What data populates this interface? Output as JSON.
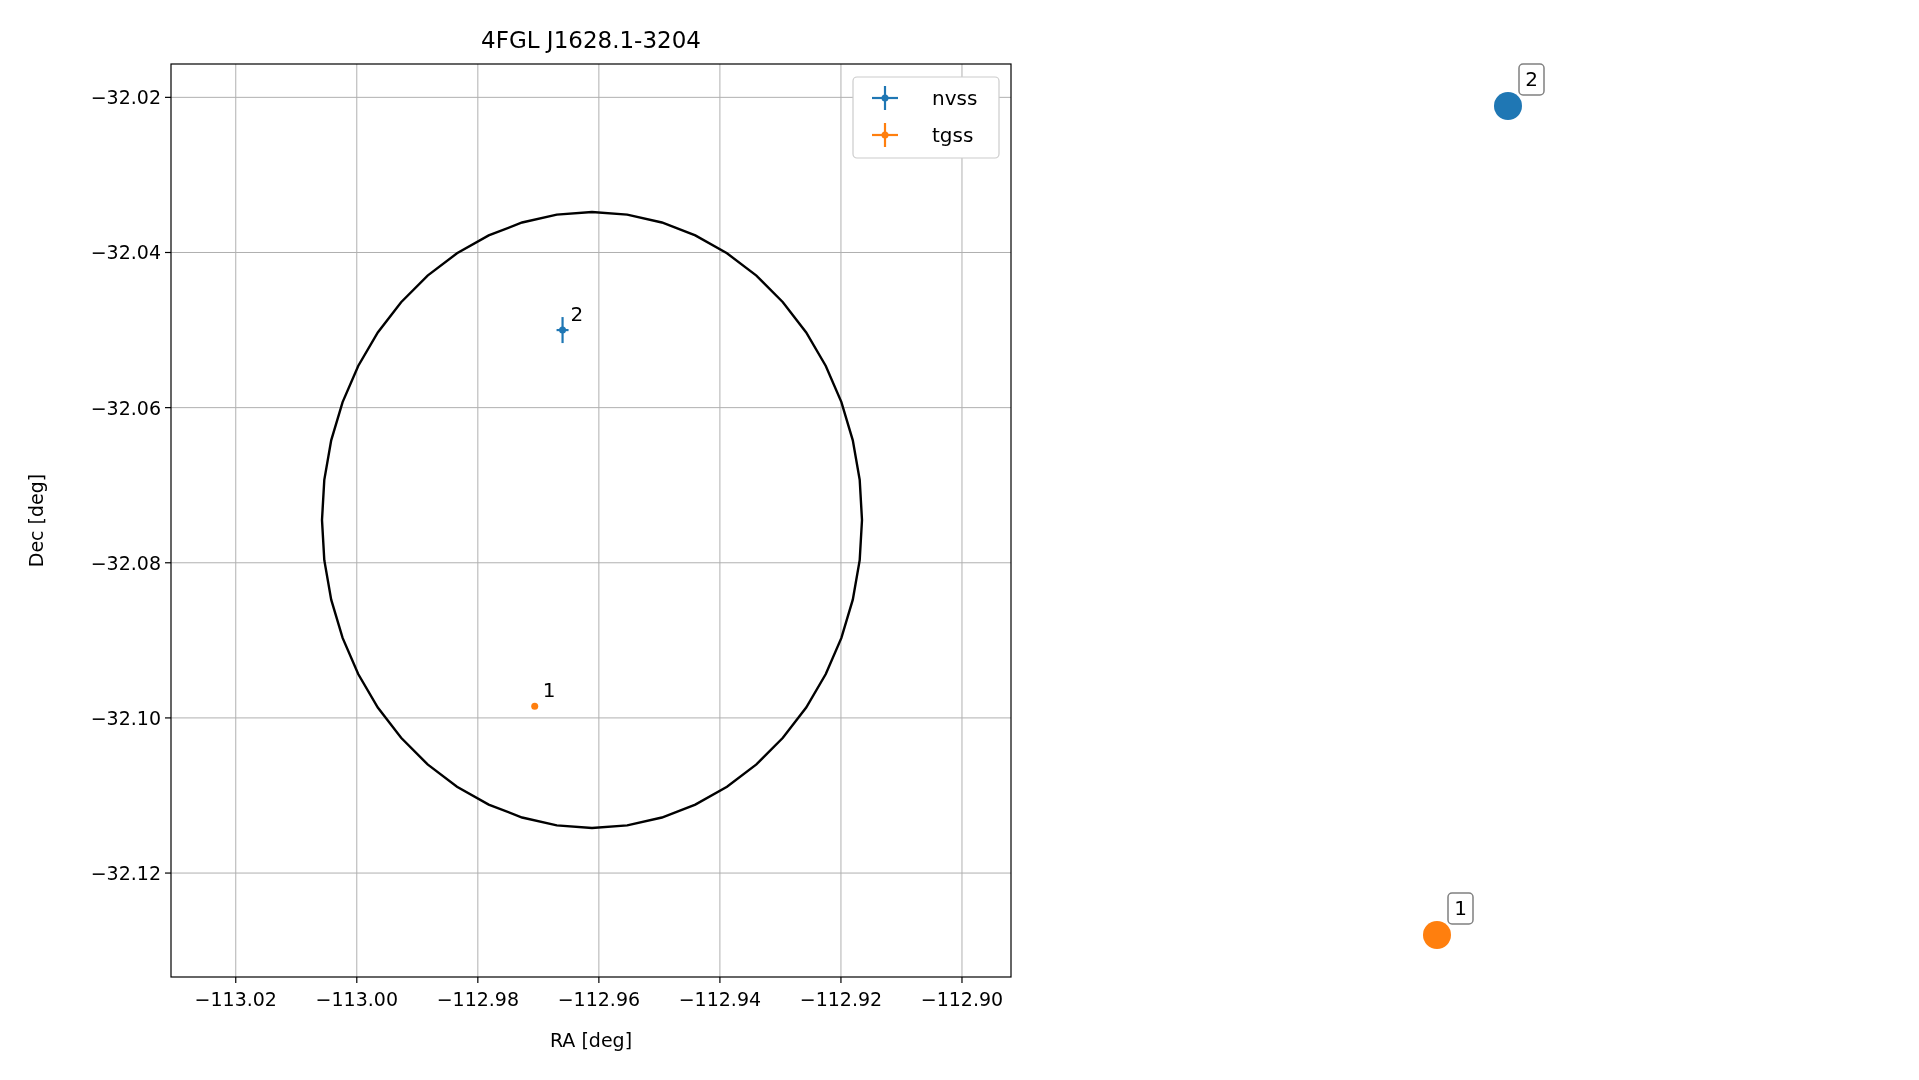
{
  "figure": {
    "chart_data": {
      "type": "scatter",
      "title": "4FGL J1628.1-3204",
      "xlabel": "RA [deg]",
      "ylabel": "Dec [deg]",
      "xlim": [
        -113.0307,
        -112.8919
      ],
      "ylim": [
        -32.1334,
        -32.0157
      ],
      "xticks": [
        {
          "value": -113.02,
          "label": "−113.02"
        },
        {
          "value": -113.0,
          "label": "−113.00"
        },
        {
          "value": -112.98,
          "label": "−112.98"
        },
        {
          "value": -112.96,
          "label": "−112.96"
        },
        {
          "value": -112.94,
          "label": "−112.94"
        },
        {
          "value": -112.92,
          "label": "−112.92"
        },
        {
          "value": -112.9,
          "label": "−112.90"
        }
      ],
      "yticks": [
        {
          "value": -32.02,
          "label": "−32.02"
        },
        {
          "value": -32.04,
          "label": "−32.04"
        },
        {
          "value": -32.06,
          "label": "−32.06"
        },
        {
          "value": -32.08,
          "label": "−32.08"
        },
        {
          "value": -32.1,
          "label": "−32.10"
        },
        {
          "value": -32.12,
          "label": "−32.12"
        }
      ],
      "grid": true,
      "legend": true,
      "series": [
        {
          "name": "nvss",
          "color": "#1f77b4",
          "x": [
            -112.966
          ],
          "values": [
            -32.05
          ]
        },
        {
          "name": "tgss",
          "color": "#ff7f0e",
          "x": [
            -112.9706
          ],
          "values": [
            -32.0985
          ]
        }
      ],
      "annotations": [
        "2",
        "1"
      ]
    }
  },
  "markers": [
    {
      "label": "2",
      "color": "#1f77b4"
    },
    {
      "label": "1",
      "color": "#ff7f0e"
    }
  ]
}
